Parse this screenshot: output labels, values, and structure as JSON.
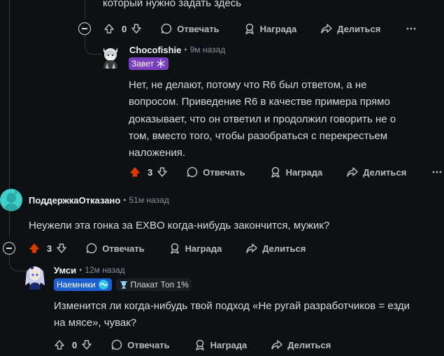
{
  "top_comment_tail": "который нужно задать здесь",
  "actions": {
    "reply": "Отвечать",
    "award": "Награда",
    "share": "Делиться"
  },
  "c1": {
    "score": "0"
  },
  "c2": {
    "author": "Chocofishie",
    "time": "9м назад",
    "flair": "Завет",
    "body": "Нет, не делают, потому что R6 был ответом, а не вопросом. Приведение R6 в качестве примера прямо доказывает, что он ответил и продолжил говорить не о том, вместо того, чтобы разобраться с перекрестьем наложения.",
    "score": "3"
  },
  "c3": {
    "author": "ПоддержкаОтказано",
    "time": "51м назад",
    "body": "Неужели эта гонка за EXBO когда-нибудь закончится, мужик?",
    "score": "3"
  },
  "c4": {
    "author": "Умси",
    "time": "12м назад",
    "flair1": "Наемники",
    "flair2": "Плакат Топ 1%",
    "body": "Изменится ли когда-нибудь твой подход «Не ругай разработчиков = езди на мясе», чувак?",
    "score": "0"
  },
  "colors": {
    "background": "#0e1113",
    "upvoted": "#d93a00",
    "flair_zavet": "#7a3fbf",
    "flair_naemniki": "#1d5fd0"
  }
}
